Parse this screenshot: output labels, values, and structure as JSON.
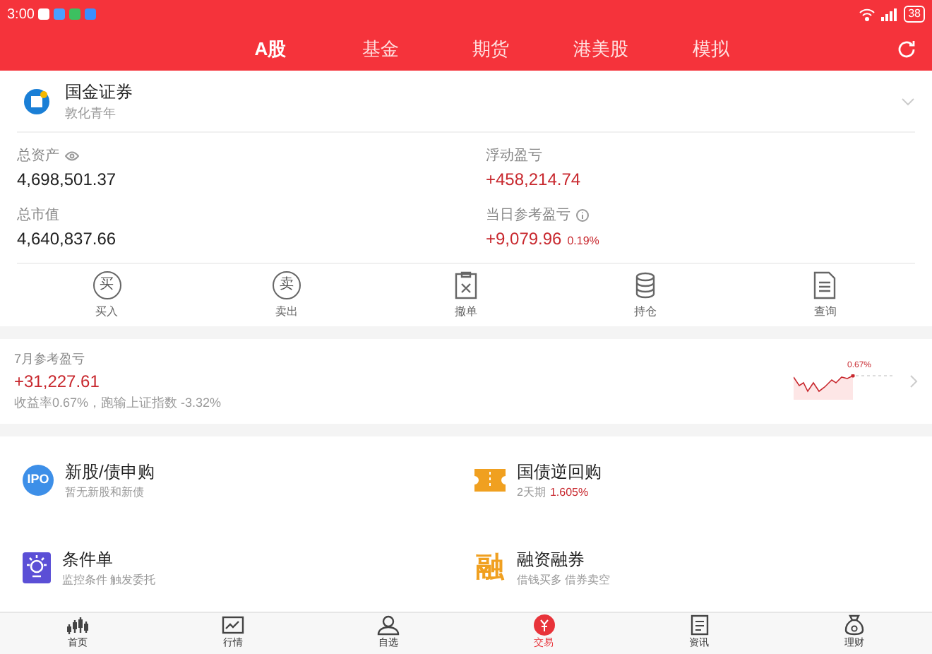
{
  "status_bar": {
    "time": "3:00",
    "battery": "38"
  },
  "tabs": [
    {
      "label": "A股",
      "selected": true
    },
    {
      "label": "基金",
      "selected": false
    },
    {
      "label": "期货",
      "selected": false
    },
    {
      "label": "港美股",
      "selected": false
    },
    {
      "label": "模拟",
      "selected": false
    }
  ],
  "account": {
    "name": "国金证券",
    "subtitle": "敦化青年"
  },
  "assets": [
    {
      "label": "总资产",
      "value": "4,698,501.37",
      "kind": "eye"
    },
    {
      "label": "浮动盈亏",
      "value": "+458,214.74",
      "kind": "plain"
    },
    {
      "label": "总市值",
      "value": "4,640,837.66",
      "kind": "plain"
    },
    {
      "label": "当日参考盈亏",
      "value": "+9,079.96",
      "extra": "0.19%",
      "kind": "info"
    }
  ],
  "actions": [
    {
      "label": "买入",
      "kind": "buy",
      "icon_text": "买"
    },
    {
      "label": "卖出",
      "kind": "sell",
      "icon_text": "卖"
    },
    {
      "label": "撤单",
      "kind": "cancel"
    },
    {
      "label": "持仓",
      "kind": "hold"
    },
    {
      "label": "查询",
      "kind": "query"
    }
  ],
  "monthly": {
    "title": "7月参考盈亏",
    "value": "+31,227.61",
    "note": "收益率0.67%，跑输上证指数 -3.32%",
    "chart_label": "0.67%"
  },
  "services": [
    {
      "title": "新股/债申购",
      "subtitle": "暂无新股和新债",
      "kind": "ipo",
      "icon_text": "IPO"
    },
    {
      "title": "国债逆回购",
      "subtitle": "2天期",
      "highlight": "1.605%",
      "kind": "ticket"
    },
    {
      "title": "条件单",
      "subtitle": "监控条件 触发委托",
      "kind": "condition"
    },
    {
      "title": "融资融券",
      "subtitle": "借钱买多 借券卖空",
      "kind": "margin",
      "icon_text": "融"
    }
  ],
  "nav": [
    {
      "label": "首页",
      "selected": false,
      "kind": "home"
    },
    {
      "label": "行情",
      "selected": false,
      "kind": "market"
    },
    {
      "label": "自选",
      "selected": false,
      "kind": "user"
    },
    {
      "label": "交易",
      "selected": true,
      "kind": "trade"
    },
    {
      "label": "资讯",
      "selected": false,
      "kind": "news"
    },
    {
      "label": "理财",
      "selected": false,
      "kind": "wealth"
    }
  ]
}
